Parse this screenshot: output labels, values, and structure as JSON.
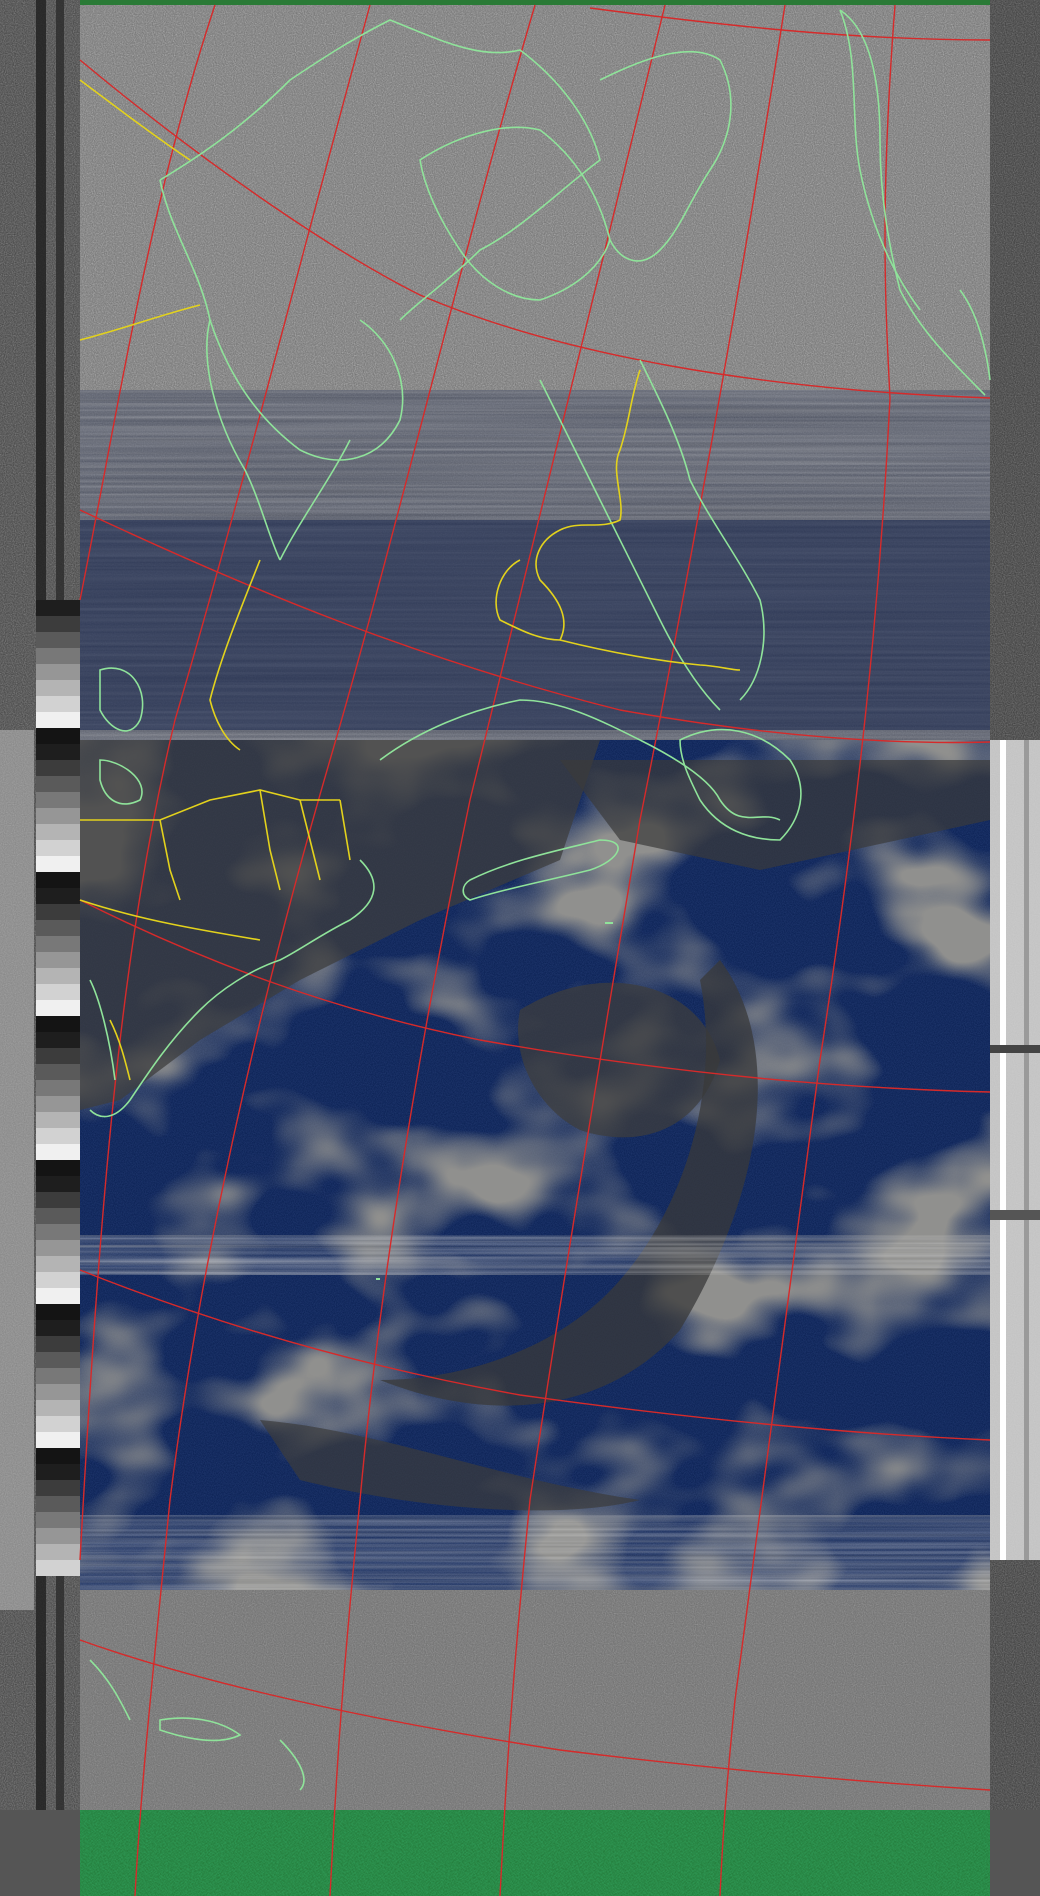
{
  "image": {
    "kind": "weather-satellite-image",
    "colors": {
      "noise_gray": "#7a7a7a",
      "ocean_blue": "#0d2356",
      "cloud_gray": "#4a4a4a",
      "coastline": "#8fe39a",
      "border": "#e3d21c",
      "graticule": "#d62a2a",
      "telemetry_green": "#1e6b2c",
      "side_strip_dark": "#2b2b2b",
      "side_strip_light": "#e6e6e6"
    }
  }
}
